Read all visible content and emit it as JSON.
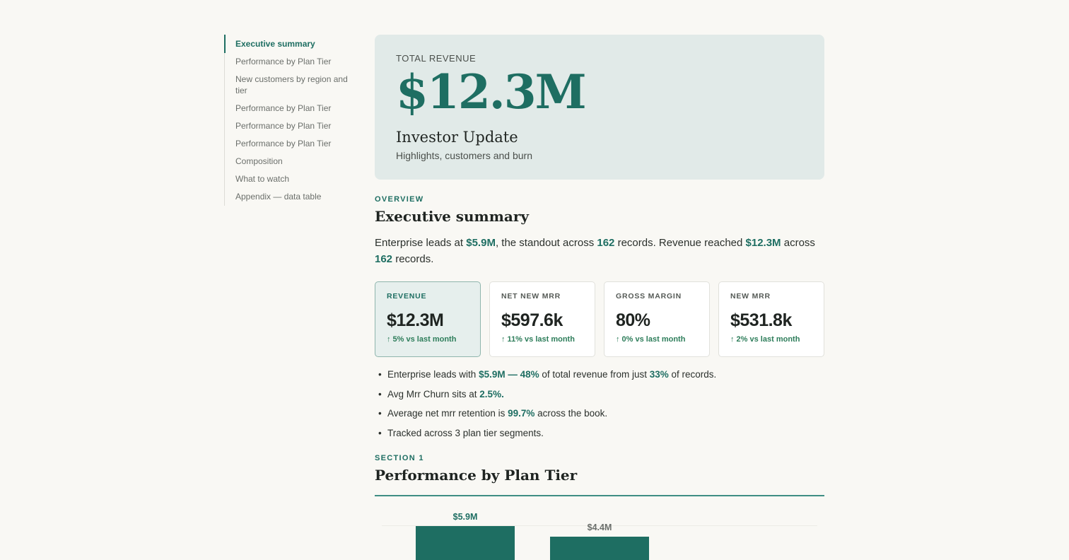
{
  "toc": [
    {
      "label": "Executive summary",
      "active": true
    },
    {
      "label": "Performance by Plan Tier"
    },
    {
      "label": "New customers by region and tier"
    },
    {
      "label": "Performance by Plan Tier"
    },
    {
      "label": "Performance by Plan Tier"
    },
    {
      "label": "Performance by Plan Tier"
    },
    {
      "label": "Composition"
    },
    {
      "label": "What to watch"
    },
    {
      "label": "Appendix — data table"
    }
  ],
  "hero": {
    "label": "TOTAL REVENUE",
    "value": "$12.3M",
    "title": "Investor Update",
    "subtitle": "Highlights, customers and burn"
  },
  "overview": {
    "eyebrow": "OVERVIEW",
    "heading": "Executive summary",
    "lead": {
      "t1": "Enterprise leads at ",
      "v1": "$5.9M",
      "t2": ", the standout across ",
      "v2": "162",
      "t3": " records. Revenue reached ",
      "v3": "$12.3M",
      "t4": " across ",
      "v4": "162",
      "t5": " records."
    }
  },
  "kpis": [
    {
      "label": "REVENUE",
      "value": "$12.3M",
      "delta": "↑ 5% vs last month"
    },
    {
      "label": "NET NEW MRR",
      "value": "$597.6k",
      "delta": "↑ 11% vs last month"
    },
    {
      "label": "GROSS MARGIN",
      "value": "80%",
      "delta": "↑ 0% vs last month"
    },
    {
      "label": "NEW MRR",
      "value": "$531.8k",
      "delta": "↑ 2% vs last month"
    }
  ],
  "bullets": {
    "b1": {
      "t1": "Enterprise leads with ",
      "v1": "$5.9M",
      "t2": " — ",
      "v2": "48%",
      "t3": " of total revenue from just ",
      "v3": "33%",
      "t4": " of records."
    },
    "b2": {
      "t1": "Avg Mrr Churn sits at ",
      "v1": "2.5%",
      "t2": "."
    },
    "b3": {
      "t1": "Average net mrr retention is ",
      "v1": "99.7%",
      "t2": " across the book."
    },
    "b4": {
      "t1": "Tracked across 3 plan tier segments."
    }
  },
  "section1": {
    "eyebrow": "SECTION 1",
    "heading": "Performance by Plan Tier"
  },
  "chart_data": {
    "type": "bar",
    "values": [
      5.9,
      4.4
    ],
    "value_labels": [
      "$5.9M",
      "$4.4M"
    ],
    "ylim": [
      0,
      5.9
    ],
    "colors": [
      "#1e6e62",
      "#1e6e62"
    ]
  }
}
